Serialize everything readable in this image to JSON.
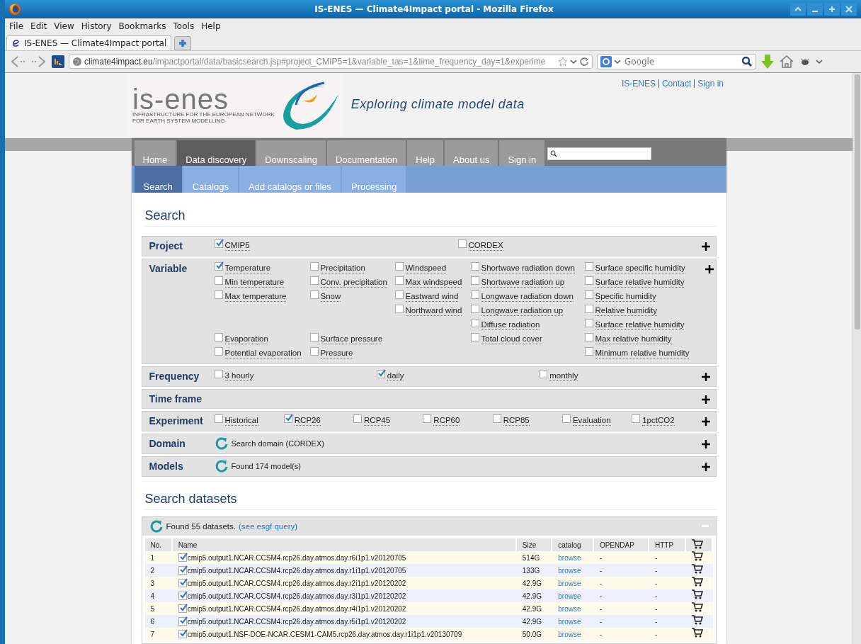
{
  "window": {
    "title": "IS-ENES — Climate4Impact portal - Mozilla Firefox"
  },
  "menu": [
    "File",
    "Edit",
    "View",
    "History",
    "Bookmarks",
    "Tools",
    "Help"
  ],
  "browser_tabs": [
    {
      "title": "IS-ENES — Climate4Impact portal",
      "selected": true
    }
  ],
  "address": {
    "host": "climate4impact.eu",
    "path": "/impactportal/data/basicsearch.jsp#project_CMIP5=1&variable_tas=1&time_frequency_day=1&experime"
  },
  "web_search": {
    "placeholder": "Google"
  },
  "page": {
    "top_links": [
      "IS-ENES",
      "Contact",
      "Sign in"
    ],
    "logo": {
      "name": "is-enes",
      "subtitle": [
        "INFRASTRUCTURE FOR THE EUROPEAN NETWORK",
        "FOR EARTH SYSTEM MODELLING"
      ]
    },
    "tagline": "Exploring climate model data",
    "nav": [
      {
        "label": "Home",
        "selected": false
      },
      {
        "label": "Data discovery",
        "selected": true
      },
      {
        "label": "Downscaling",
        "selected": false
      },
      {
        "label": "Documentation",
        "selected": false
      },
      {
        "label": "Help",
        "selected": false
      },
      {
        "label": "About us",
        "selected": false
      },
      {
        "label": "Sign in",
        "selected": false
      }
    ],
    "subnav": [
      {
        "label": "Search",
        "selected": true
      },
      {
        "label": "Catalogs",
        "selected": false
      },
      {
        "label": "Add catalogs or files",
        "selected": false
      },
      {
        "label": "Processing",
        "selected": false
      }
    ],
    "search_heading": "Search",
    "facets": [
      {
        "label": "Project",
        "kind": "options",
        "options": [
          {
            "label": "CMIP5",
            "checked": true
          },
          {
            "label": "CORDEX",
            "checked": false
          }
        ]
      },
      {
        "label": "Variable",
        "kind": "grid",
        "rows": [
          [
            {
              "label": "Temperature",
              "checked": true
            },
            {
              "label": "Precipitation",
              "checked": false
            },
            {
              "label": "Windspeed",
              "checked": false
            },
            {
              "label": "Shortwave radiation down",
              "checked": false
            },
            {
              "label": "Surface specific humidity",
              "checked": false
            }
          ],
          [
            {
              "label": "Min temperature",
              "checked": false
            },
            {
              "label": "Conv. precipitation",
              "checked": false
            },
            {
              "label": "Max windspeed",
              "checked": false
            },
            {
              "label": "Shortwave radiation up",
              "checked": false
            },
            {
              "label": "Surface relative humidity",
              "checked": false
            }
          ],
          [
            {
              "label": "Max temperature",
              "checked": false
            },
            {
              "label": "Snow",
              "checked": false
            },
            {
              "label": "Eastward wind",
              "checked": false
            },
            {
              "label": "Longwave radiation down",
              "checked": false
            },
            {
              "label": "Specific humidity",
              "checked": false
            }
          ],
          [
            null,
            null,
            {
              "label": "Northward wind",
              "checked": false
            },
            {
              "label": "Longwave radiation up",
              "checked": false
            },
            {
              "label": "Relative humidity",
              "checked": false
            }
          ],
          [
            null,
            null,
            null,
            {
              "label": "Diffuse radiation",
              "checked": false
            },
            {
              "label": "Surface relative humidity",
              "checked": false
            }
          ],
          [
            {
              "label": "Evaporation",
              "checked": false
            },
            {
              "label": "Surface pressure",
              "checked": false
            },
            null,
            {
              "label": "Total cloud cover",
              "checked": false
            },
            {
              "label": "Max relative humidity",
              "checked": false
            }
          ],
          [
            {
              "label": "Potential evaporation",
              "checked": false
            },
            {
              "label": "Pressure",
              "checked": false
            },
            null,
            null,
            {
              "label": "Minimum relative humidity",
              "checked": false
            }
          ]
        ]
      },
      {
        "label": "Frequency",
        "kind": "options",
        "options": [
          {
            "label": "3 hourly",
            "checked": false
          },
          {
            "label": "daily",
            "checked": true
          },
          {
            "label": "monthly",
            "checked": false
          }
        ]
      },
      {
        "label": "Time frame",
        "kind": "empty"
      },
      {
        "label": "Experiment",
        "kind": "options",
        "options": [
          {
            "label": "Historical",
            "checked": false
          },
          {
            "label": "RCP26",
            "checked": true
          },
          {
            "label": "RCP45",
            "checked": false
          },
          {
            "label": "RCP60",
            "checked": false
          },
          {
            "label": "RCP85",
            "checked": false
          },
          {
            "label": "Evaluation",
            "checked": false
          },
          {
            "label": "1pctCO2",
            "checked": false
          }
        ]
      },
      {
        "label": "Domain",
        "kind": "status",
        "text": "Search domain (CORDEX)"
      },
      {
        "label": "Models",
        "kind": "status",
        "text": "Found 174 model(s)"
      }
    ],
    "datasets_heading": "Search datasets",
    "datasets": {
      "summary": "Found 55 datasets.",
      "link": "(see esgf query)",
      "columns": [
        "No.",
        "Name",
        "Size",
        "catalog",
        "OPENDAP",
        "HTTP"
      ],
      "rows": [
        {
          "no": "1",
          "name": "cmip5.output1.NCAR.CCSM4.rcp26.day.atmos.day.r6i1p1.v20120705",
          "checked": true,
          "size": "514G",
          "catalog": "browse",
          "opendap": "-",
          "http": "-"
        },
        {
          "no": "2",
          "name": "cmip5.output1.NCAR.CCSM4.rcp26.day.atmos.day.r1i1p1.v20120705",
          "checked": true,
          "size": "133G",
          "catalog": "browse",
          "opendap": "-",
          "http": "-"
        },
        {
          "no": "3",
          "name": "cmip5.output1.NCAR.CCSM4.rcp26.day.atmos.day.r2i1p1.v20120202",
          "checked": true,
          "size": "42.9G",
          "catalog": "browse",
          "opendap": "-",
          "http": "-"
        },
        {
          "no": "4",
          "name": "cmip5.output1.NCAR.CCSM4.rcp26.day.atmos.day.r3i1p1.v20120202",
          "checked": true,
          "size": "42.9G",
          "catalog": "browse",
          "opendap": "-",
          "http": "-"
        },
        {
          "no": "5",
          "name": "cmip5.output1.NCAR.CCSM4.rcp26.day.atmos.day.r4i1p1.v20120202",
          "checked": true,
          "size": "42.9G",
          "catalog": "browse",
          "opendap": "-",
          "http": "-"
        },
        {
          "no": "6",
          "name": "cmip5.output1.NCAR.CCSM4.rcp26.day.atmos.day.r5i1p1.v20120202",
          "checked": true,
          "size": "42.9G",
          "catalog": "browse",
          "opendap": "-",
          "http": "-"
        },
        {
          "no": "7",
          "name": "cmip5.output1.NSF-DOE-NCAR.CESM1-CAM5.rcp26.day.atmos.day.r1i1p1.v20130709",
          "checked": true,
          "size": "50.0G",
          "catalog": "browse",
          "opendap": "-",
          "http": "-"
        }
      ]
    }
  }
}
